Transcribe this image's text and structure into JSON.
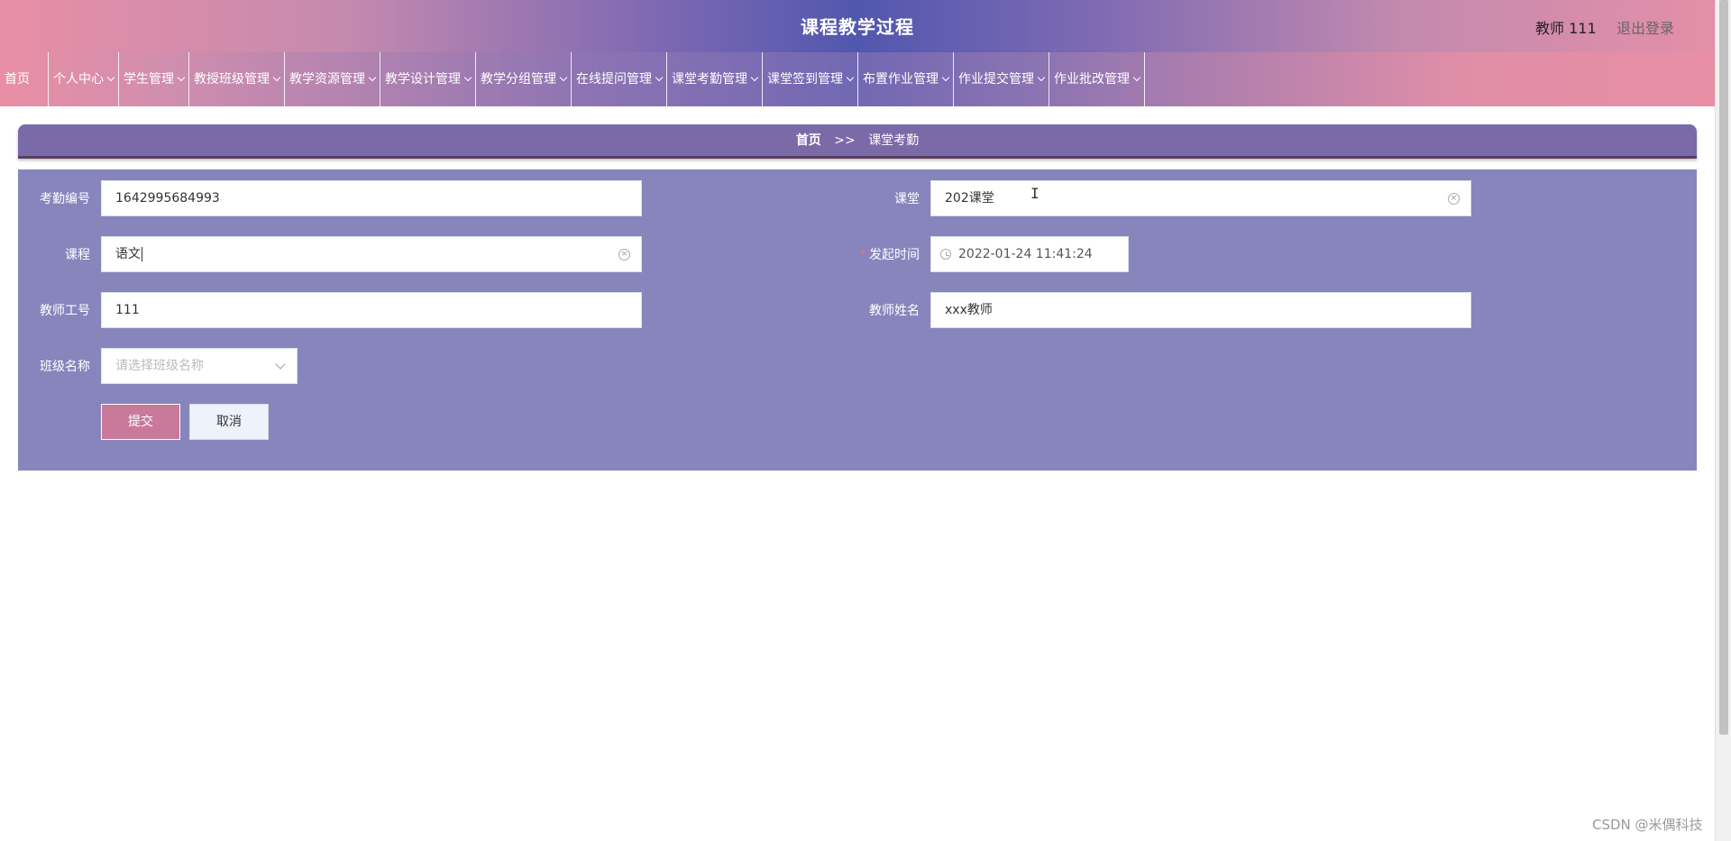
{
  "header": {
    "title": "课程教学过程",
    "user": "教师 111",
    "logout": "退出登录"
  },
  "nav": {
    "items": [
      {
        "label": "首页",
        "dropdown": false
      },
      {
        "label": "个人中心",
        "dropdown": true
      },
      {
        "label": "学生管理",
        "dropdown": true
      },
      {
        "label": "教授班级管理",
        "dropdown": true
      },
      {
        "label": "教学资源管理",
        "dropdown": true
      },
      {
        "label": "教学设计管理",
        "dropdown": true
      },
      {
        "label": "教学分组管理",
        "dropdown": true
      },
      {
        "label": "在线提问管理",
        "dropdown": true
      },
      {
        "label": "课堂考勤管理",
        "dropdown": true
      },
      {
        "label": "课堂签到管理",
        "dropdown": true
      },
      {
        "label": "布置作业管理",
        "dropdown": true
      },
      {
        "label": "作业提交管理",
        "dropdown": true
      },
      {
        "label": "作业批改管理",
        "dropdown": true
      }
    ]
  },
  "breadcrumb": {
    "home": "首页",
    "separator": ">>",
    "current": "课堂考勤"
  },
  "form": {
    "attendance_no": {
      "label": "考勤编号",
      "value": "1642995684993"
    },
    "classroom": {
      "label": "课堂",
      "value": "202课堂"
    },
    "course": {
      "label": "课程",
      "value": "语文"
    },
    "start_time": {
      "label": "发起时间",
      "required_mark": "*",
      "value": "2022-01-24 11:41:24"
    },
    "teacher_id": {
      "label": "教师工号",
      "value": "111"
    },
    "teacher_name": {
      "label": "教师姓名",
      "value": "xxx教师"
    },
    "class_name": {
      "label": "班级名称",
      "placeholder": "请选择班级名称"
    },
    "submit_label": "提交",
    "cancel_label": "取消"
  },
  "watermark": "CSDN @米偶科技",
  "colors": {
    "panel": "#8885bd",
    "breadcrumb": "#7b6aa8",
    "submit": "#c9799a",
    "required": "#f56c6c"
  }
}
